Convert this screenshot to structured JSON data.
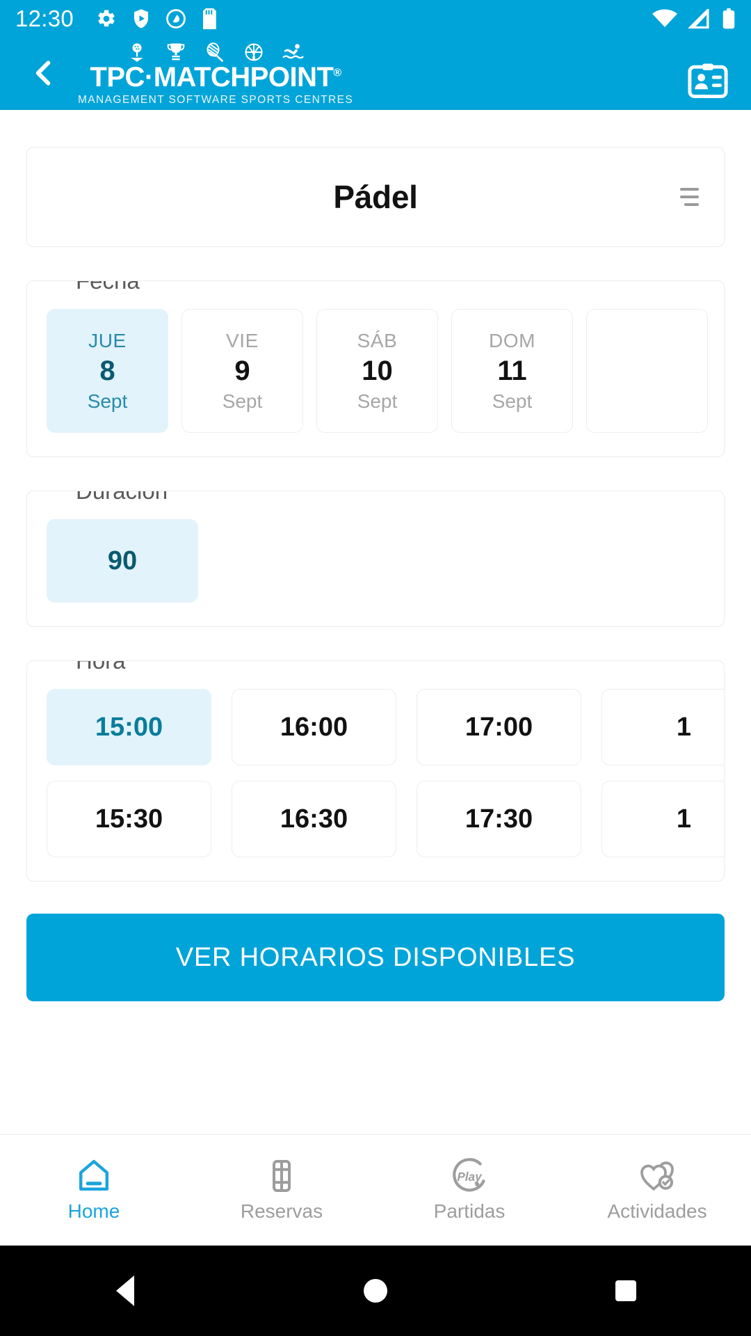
{
  "status_bar": {
    "time": "12:30",
    "left_icons": [
      "gear-icon",
      "play-protect-icon",
      "quick-settings-icon",
      "sd-card-icon"
    ],
    "right_icons": [
      "wifi-icon",
      "cellular-signal-icon",
      "battery-icon"
    ]
  },
  "header": {
    "back_label": "back-arrow",
    "brand": "TPC·MATCHPOINT",
    "brand_registered": "®",
    "tagline": "MANAGEMENT SOFTWARE SPORTS CENTRES",
    "sport_icons": [
      "golf-icon",
      "trophy-icon",
      "racket-icon",
      "basketball-icon",
      "swimming-icon"
    ],
    "action_icon": "id-card-icon",
    "background_color": "#00a4d8"
  },
  "sport_card": {
    "title": "Pádel",
    "menu_icon": "hamburger-menu-icon"
  },
  "date_section": {
    "label": "Fecha",
    "chips": [
      {
        "dow": "JUE",
        "day": "8",
        "month": "Sept",
        "selected": true
      },
      {
        "dow": "VIE",
        "day": "9",
        "month": "Sept",
        "selected": false
      },
      {
        "dow": "SÁB",
        "day": "10",
        "month": "Sept",
        "selected": false
      },
      {
        "dow": "DOM",
        "day": "11",
        "month": "Sept",
        "selected": false
      },
      {
        "dow": "",
        "day": "",
        "month": "",
        "selected": false
      }
    ]
  },
  "duration_section": {
    "label": "Duración",
    "chips": [
      {
        "value": "90",
        "selected": true
      }
    ]
  },
  "time_section": {
    "label": "Hora",
    "chips": [
      {
        "value": "15:00",
        "selected": true
      },
      {
        "value": "16:00",
        "selected": false
      },
      {
        "value": "17:00",
        "selected": false
      },
      {
        "value": "1",
        "selected": false
      },
      {
        "value": "15:30",
        "selected": false
      },
      {
        "value": "16:30",
        "selected": false
      },
      {
        "value": "17:30",
        "selected": false
      },
      {
        "value": "1",
        "selected": false
      }
    ]
  },
  "cta": {
    "label": "VER HORARIOS DISPONIBLES",
    "color": "#00a4d8"
  },
  "bottom_nav": {
    "active_color": "#1ba4dd",
    "inactive_color": "#9d9d9d",
    "items": [
      {
        "label": "Home",
        "icon": "home-icon",
        "active": true
      },
      {
        "label": "Reservas",
        "icon": "court-icon",
        "active": false
      },
      {
        "label": "Partidas",
        "icon": "play-icon",
        "active": false
      },
      {
        "label": "Actividades",
        "icon": "hearts-check-icon",
        "active": false
      }
    ]
  },
  "android_nav": {
    "back": "back-triangle-icon",
    "home": "home-circle-icon",
    "recents": "recents-square-icon"
  }
}
